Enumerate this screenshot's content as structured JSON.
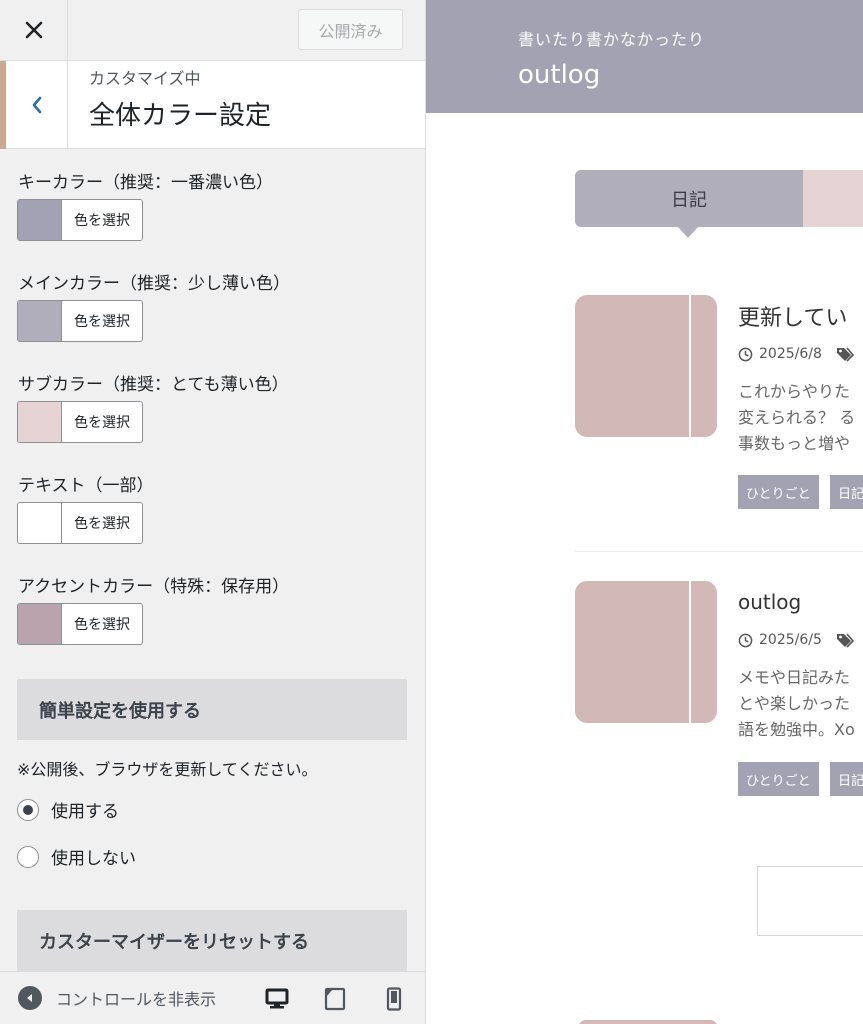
{
  "topbar": {
    "publish_label": "公開済み"
  },
  "section": {
    "subtitle": "カスタマイズ中",
    "title": "全体カラー設定"
  },
  "colors": [
    {
      "label": "キーカラー（推奨：一番濃い色）",
      "button": "色を選択",
      "swatch": "#a2a2b2"
    },
    {
      "label": "メインカラー（推奨：少し薄い色）",
      "button": "色を選択",
      "swatch": "#b0aebb"
    },
    {
      "label": "サブカラー（推奨：とても薄い色）",
      "button": "色を選択",
      "swatch": "#e5d4d3"
    },
    {
      "label": "テキスト（一部）",
      "button": "色を選択",
      "swatch": "#ffffff"
    },
    {
      "label": "アクセントカラー（特殊：保存用）",
      "button": "色を選択",
      "swatch": "#b9a3ad"
    }
  ],
  "simple": {
    "heading": "簡単設定を使用する",
    "note": "※公開後、ブラウザを更新してください。",
    "options": [
      {
        "label": "使用する",
        "selected": true
      },
      {
        "label": "使用しない",
        "selected": false
      }
    ]
  },
  "reset": {
    "heading": "カスターマイザーをリセットする"
  },
  "footer": {
    "collapse_label": "コントロールを非表示"
  },
  "preview": {
    "tagline": "書いたり書かなかったり",
    "site_title": "outlog",
    "tabs": [
      {
        "label": "日記"
      }
    ],
    "posts": [
      {
        "title": "更新してい",
        "date": "2025/6/8",
        "excerpt": [
          "これからやりた",
          "変えられる？ る",
          "事数もっと増や"
        ],
        "tags": [
          "ひとりごと",
          "日記"
        ]
      },
      {
        "title": "outlog",
        "date": "2025/6/5",
        "excerpt": [
          "メモや日記みた",
          "とや楽しかった",
          "語を勉強中。Xo"
        ],
        "tags": [
          "ひとりごと",
          "日記"
        ]
      }
    ]
  }
}
